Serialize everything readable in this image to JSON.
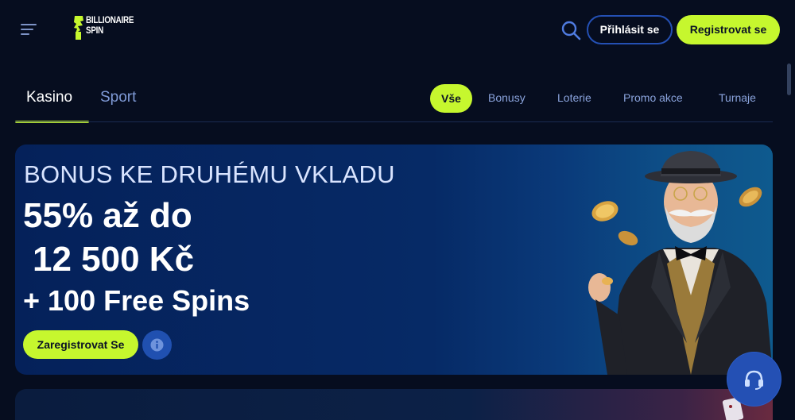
{
  "header": {
    "logo_text_line1": "BILLIONAIRE",
    "logo_text_line2": "SPIN",
    "login_label": "Přihlásit se",
    "register_label": "Registrovat se"
  },
  "tabs": {
    "main": [
      {
        "label": "Kasino",
        "active": true
      },
      {
        "label": "Sport",
        "active": false
      }
    ],
    "filters": [
      {
        "label": "Vše",
        "active": true
      },
      {
        "label": "Bonusy",
        "active": false
      },
      {
        "label": "Loterie",
        "active": false
      },
      {
        "label": "Promo akce",
        "active": false
      },
      {
        "label": "Turnaje",
        "active": false
      }
    ]
  },
  "banner": {
    "headline": "BONUS KE DRUHÉMU VKLADU",
    "line1": "55% až do",
    "line2": "12 500 Kč",
    "line3": "+ 100 Free Spins",
    "cta_label": "Zaregistrovat Se"
  },
  "icons": {
    "menu": "menu-icon",
    "search": "search-icon",
    "info": "info-icon",
    "support": "headset-icon"
  },
  "colors": {
    "accent": "#c6f72e",
    "background": "#060d1f",
    "banner": "#05215a",
    "link": "#7f9ad6",
    "button_blue": "#2450b4"
  }
}
